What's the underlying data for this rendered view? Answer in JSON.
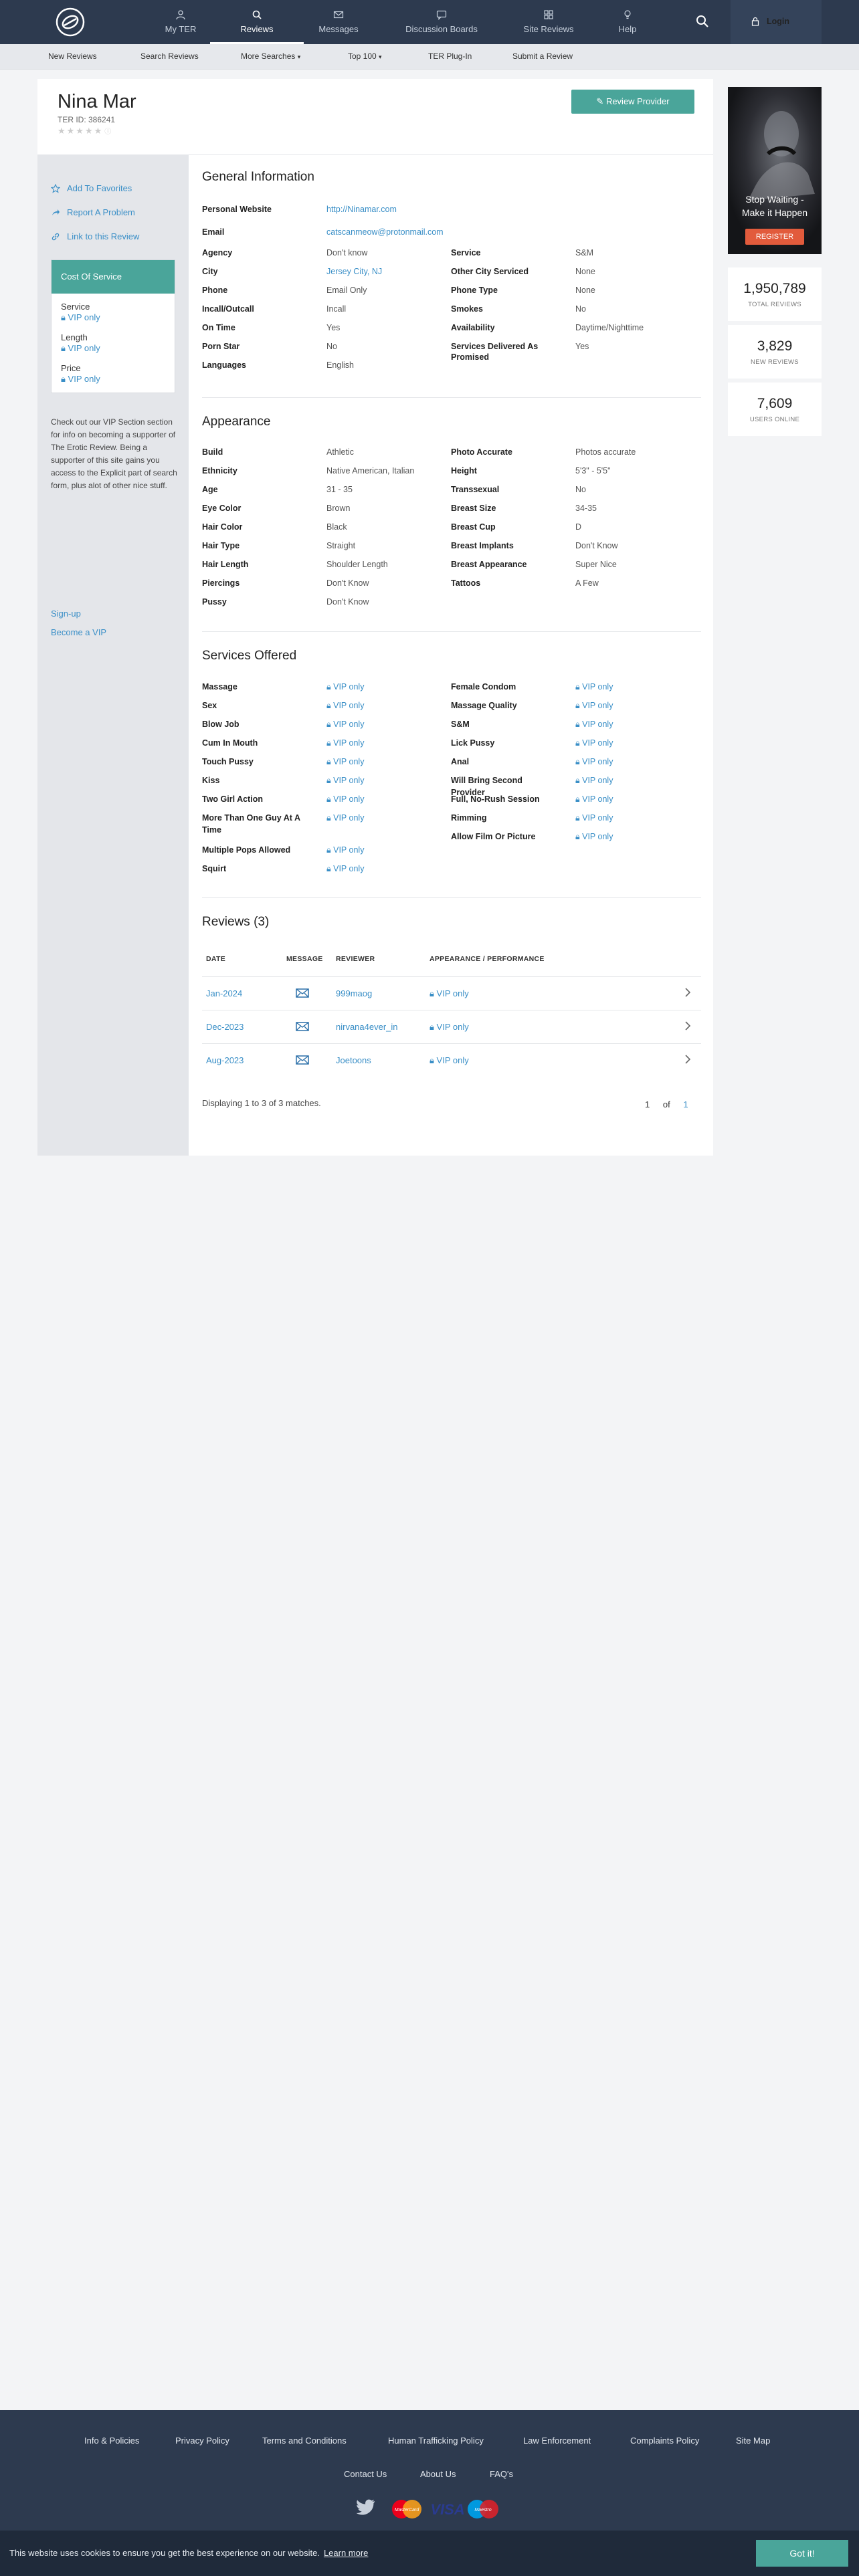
{
  "nav": {
    "items": [
      {
        "label": "My TER",
        "icon": "user-icon"
      },
      {
        "label": "Reviews",
        "icon": "search-icon"
      },
      {
        "label": "Messages",
        "icon": "envelope-icon"
      },
      {
        "label": "Discussion Boards",
        "icon": "chat-icon"
      },
      {
        "label": "Site Reviews",
        "icon": "grid-icon"
      },
      {
        "label": "Help",
        "icon": "lightbulb-icon"
      }
    ],
    "login_label": "Login"
  },
  "subnav": [
    "New Reviews",
    "Search Reviews",
    "More Searches",
    "Top 100",
    "TER Plug-In",
    "Submit a Review"
  ],
  "provider": {
    "name": "Nina Mar",
    "ter_id": "TER ID: 386241",
    "review_button": "Review Provider"
  },
  "sidebar": {
    "add_favorites": "Add To Favorites",
    "report_problem": "Report A Problem",
    "link_review": "Link to this Review",
    "cost_title": "Cost Of Service",
    "cost_items": [
      {
        "label": "Service",
        "value": "VIP only"
      },
      {
        "label": "Length",
        "value": "VIP only"
      },
      {
        "label": "Price",
        "value": "VIP only"
      }
    ],
    "vip_note": "Check out our VIP Section section for info on becoming a supporter of The Erotic Review. Being a supporter of this site gains you access to the Explicit part of search form, plus alot of other nice stuff.",
    "signup": "Sign-up",
    "become_vip": "Become a VIP"
  },
  "general": {
    "title": "General Information",
    "website_label": "Personal Website",
    "website_value": "http://Ninamar.com",
    "email_label": "Email",
    "email_value": "catscanmeow@protonmail.com",
    "left": [
      {
        "label": "Agency",
        "value": "Don't know"
      },
      {
        "label": "City",
        "value": "Jersey City, NJ"
      },
      {
        "label": "Phone",
        "value": "Email Only"
      },
      {
        "label": "Incall/Outcall",
        "value": "Incall"
      },
      {
        "label": "On Time",
        "value": "Yes"
      },
      {
        "label": "Porn Star",
        "value": "No"
      },
      {
        "label": "Languages",
        "value": "English"
      }
    ],
    "right": [
      {
        "label": "Service",
        "value": "S&M"
      },
      {
        "label": "Other City Serviced",
        "value": "None"
      },
      {
        "label": "Phone Type",
        "value": "None"
      },
      {
        "label": "Smokes",
        "value": "No"
      },
      {
        "label": "Availability",
        "value": "Daytime/Nighttime"
      },
      {
        "label": "Services Delivered As Promised",
        "value": "Yes"
      }
    ]
  },
  "appearance": {
    "title": "Appearance",
    "left": [
      {
        "label": "Build",
        "value": "Athletic"
      },
      {
        "label": "Ethnicity",
        "value": "Native American, Italian"
      },
      {
        "label": "Age",
        "value": "31 - 35"
      },
      {
        "label": "Eye Color",
        "value": "Brown"
      },
      {
        "label": "Hair Color",
        "value": "Black"
      },
      {
        "label": "Hair Type",
        "value": "Straight"
      },
      {
        "label": "Hair Length",
        "value": "Shoulder Length"
      },
      {
        "label": "Piercings",
        "value": "Don't Know"
      },
      {
        "label": "Pussy",
        "value": "Don't Know"
      }
    ],
    "right": [
      {
        "label": "Photo Accurate",
        "value": "Photos accurate"
      },
      {
        "label": "Height",
        "value": "5'3\" - 5'5\""
      },
      {
        "label": "Transsexual",
        "value": "No"
      },
      {
        "label": "Breast Size",
        "value": "34-35"
      },
      {
        "label": "Breast Cup",
        "value": "D"
      },
      {
        "label": "Breast Implants",
        "value": "Don't Know"
      },
      {
        "label": "Breast Appearance",
        "value": "Super Nice"
      },
      {
        "label": "Tattoos",
        "value": "A Few"
      }
    ]
  },
  "services": {
    "title": "Services Offered",
    "vip_text": "VIP only",
    "left": [
      "Massage",
      "Sex",
      "Blow Job",
      "Cum In Mouth",
      "Touch Pussy",
      "Kiss",
      "Two Girl Action",
      "More Than One Guy At A Time",
      "Multiple Pops Allowed",
      "Squirt"
    ],
    "right": [
      "Female Condom",
      "Massage Quality",
      "S&M",
      "Lick Pussy",
      "Anal",
      "Will Bring Second Provider",
      "Full, No-Rush Session",
      "Rimming",
      "Allow Film Or Picture"
    ]
  },
  "reviews": {
    "title": "Reviews (3)",
    "headers": [
      "DATE",
      "MESSAGE",
      "REVIEWER",
      "APPEARANCE / PERFORMANCE"
    ],
    "rows": [
      {
        "date": "Jan-2024",
        "reviewer": "999maog",
        "value": "VIP only"
      },
      {
        "date": "Dec-2023",
        "reviewer": "nirvana4ever_in",
        "value": "VIP only"
      },
      {
        "date": "Aug-2023",
        "reviewer": "Joetoons",
        "value": "VIP only"
      }
    ],
    "displaying": "Displaying 1 to 3 of 3 matches.",
    "page_current": "1",
    "page_of": "of",
    "page_total": "1"
  },
  "ad": {
    "line1": "Stop Waiting -",
    "line2": "Make it Happen",
    "button": "REGISTER"
  },
  "stats": [
    {
      "number": "1,950,789",
      "label": "TOTAL REVIEWS"
    },
    {
      "number": "3,829",
      "label": "NEW REVIEWS"
    },
    {
      "number": "7,609",
      "label": "USERS ONLINE"
    }
  ],
  "footer": {
    "links1": [
      "Info & Policies",
      "Privacy Policy",
      "Terms and Conditions",
      "Human Trafficking Policy",
      "Law Enforcement",
      "Complaints Policy",
      "Site Map"
    ],
    "links2": [
      "Contact Us",
      "About Us",
      "FAQ's"
    ],
    "payments": [
      "MasterCard",
      "VISA",
      "Maestro"
    ]
  },
  "cookie": {
    "text": "This website uses cookies to ensure you get the best experience on our website.",
    "learn_more": "Learn more",
    "button": "Got it!"
  },
  "colors": {
    "nav_bg": "#2d3a4f",
    "accent": "#4aa59a",
    "link": "#3a8fc7",
    "ad_button": "#e25b3c"
  }
}
